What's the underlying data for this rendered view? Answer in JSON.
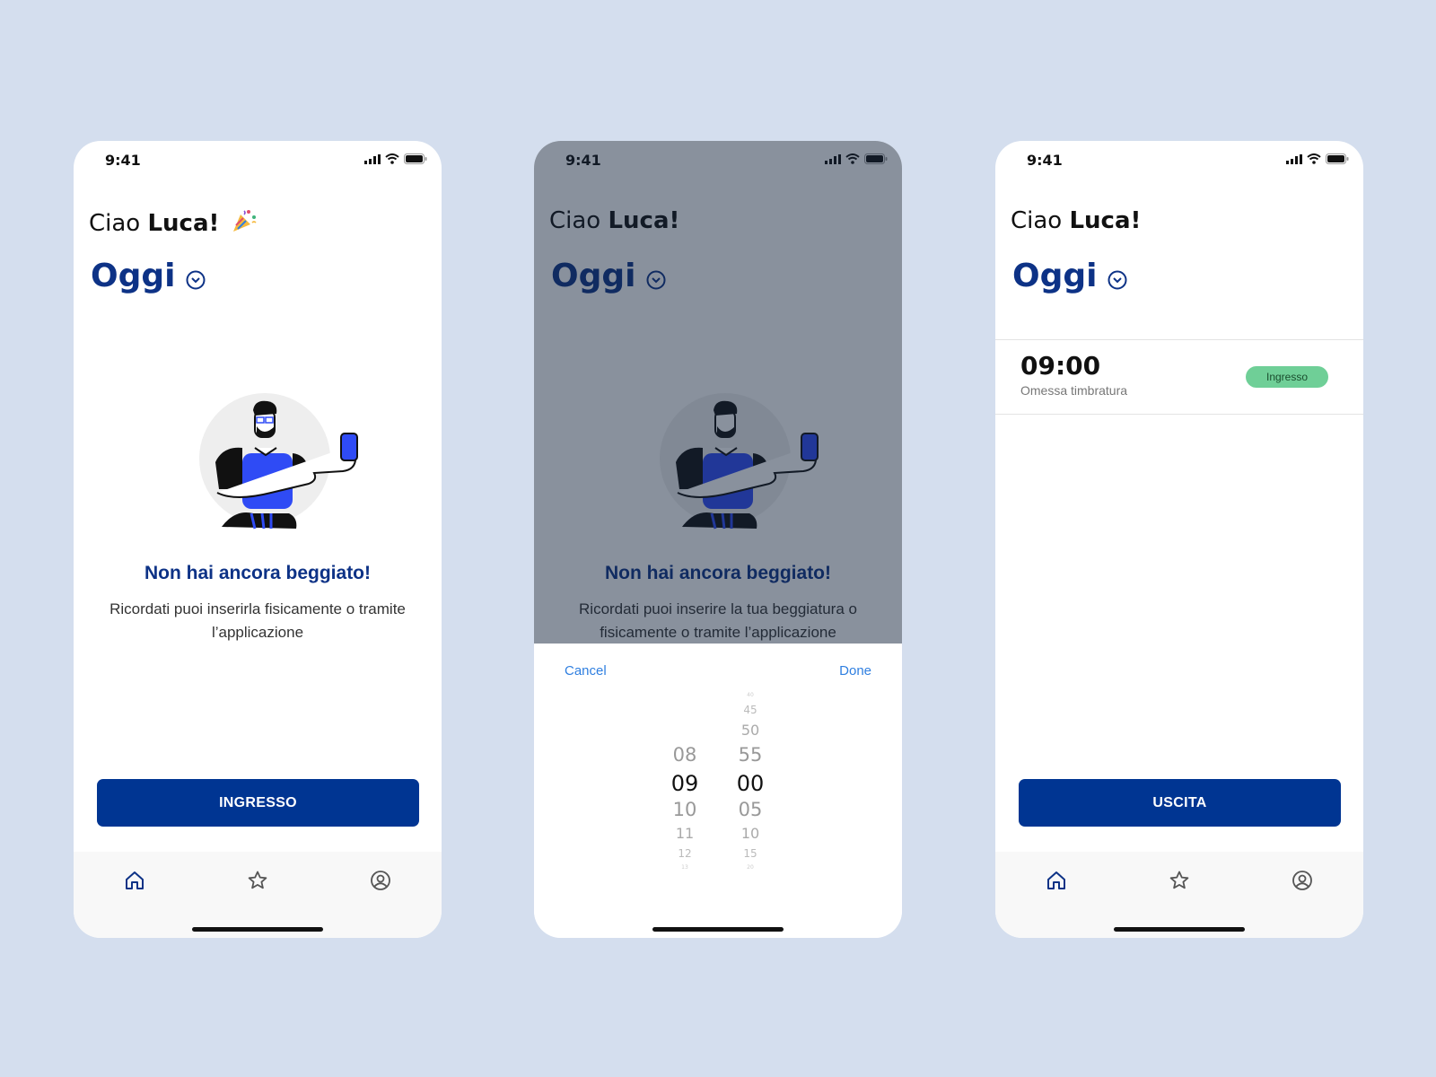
{
  "status": {
    "time": "9:41"
  },
  "greeting": {
    "prefix": "Ciao",
    "name": "Luca!"
  },
  "title": "Oggi",
  "empty": {
    "title": "Non hai ancora beggiato!",
    "subtitle_1": "Ricordati puoi inserirla fisicamente o tramite l’applicazione",
    "subtitle_2": "Ricordati puoi inserire la tua beggiatura o fisicamente o tramite l’applicazione"
  },
  "buttons": {
    "ingresso": "INGRESSO",
    "uscita": "USCITA"
  },
  "picker": {
    "cancel": "Cancel",
    "done": "Done",
    "hours": [
      "08",
      "09",
      "10",
      "11",
      "12",
      "13"
    ],
    "minutes": [
      "40",
      "45",
      "50",
      "55",
      "00",
      "05",
      "10",
      "15",
      "20"
    ],
    "selected_hour": "09",
    "selected_minute": "00"
  },
  "record": {
    "time": "09:00",
    "note": "Omessa timbratura",
    "badge": "Ingresso"
  },
  "tabs": [
    "home-icon",
    "star-icon",
    "profile-icon"
  ],
  "colors": {
    "brand": "#003592",
    "title": "#0d3286",
    "badge": "#6fcf97",
    "link": "#2f7fe0",
    "background": "#d4deee"
  }
}
